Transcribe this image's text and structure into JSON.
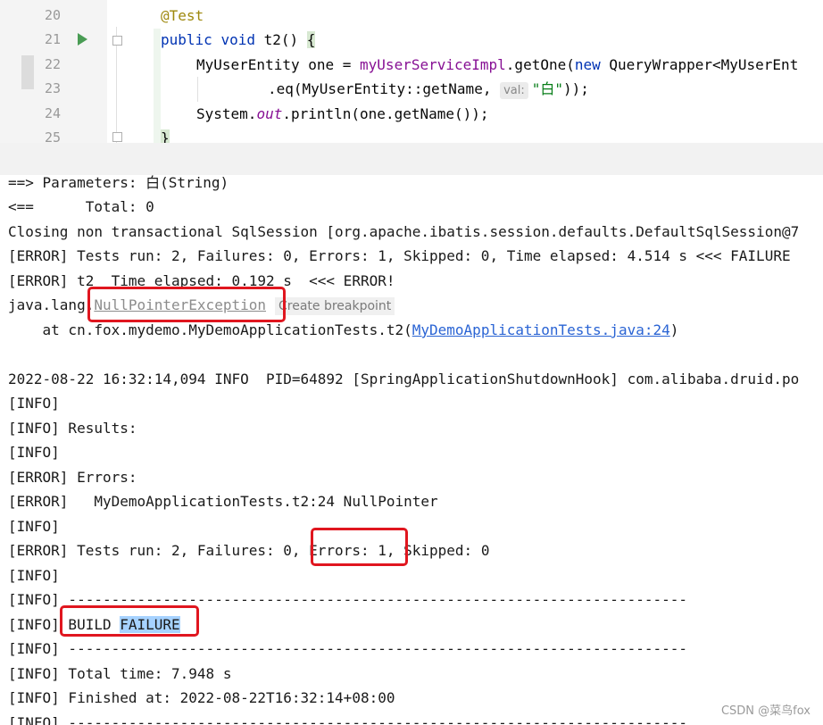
{
  "editor": {
    "line_numbers": [
      "20",
      "21",
      "22",
      "23",
      "24",
      "25"
    ],
    "line20": {
      "annotation": "@Test"
    },
    "line21": {
      "kw_public": "public",
      "kw_void": "void",
      "method": " t2() ",
      "brace": "{"
    },
    "line22": {
      "a": "MyUserEntity one = ",
      "b": "myUserServiceImpl",
      "c": ".getOne(",
      "kw_new": "new",
      "d": " QueryWrapper<MyUserEnt"
    },
    "line23": {
      "a": ".eq(MyUserEntity::getName, ",
      "hint": "val:",
      "str": "\"白\"",
      "b": "));"
    },
    "line24": {
      "a": "System.",
      "out": "out",
      "b": ".println(one.getName());"
    },
    "line25": {
      "brace": "}"
    }
  },
  "console": {
    "l1": "==> Parameters: 白(String)",
    "l2": "<==      Total: 0",
    "l3": "Closing non transactional SqlSession [org.apache.ibatis.session.defaults.DefaultSqlSession@7",
    "l4": "[ERROR] Tests run: 2, Failures: 0, Errors: 1, Skipped: 0, Time elapsed: 4.514 s <<< FAILURE",
    "l5": "[ERROR] t2  Time elapsed: 0.192 s  <<< ERROR!",
    "l6": {
      "prefix": "java.lang.",
      "exception": "NullPointerException",
      "chip": "Create breakpoint"
    },
    "l7": {
      "prefix": "    at cn.fox.mydemo.MyDemoApplicationTests.t2(",
      "link": "MyDemoApplicationTests.java:24",
      "suffix": ")"
    },
    "l9": "2022-08-22 16:32:14,094 INFO  PID=64892 [SpringApplicationShutdownHook] com.alibaba.druid.po",
    "l10": "[INFO]",
    "l11": "[INFO] Results:",
    "l12": "[INFO]",
    "l13": "[ERROR] Errors:",
    "l14": "[ERROR]   MyDemoApplicationTests.t2:24 NullPointer",
    "l15": "[INFO]",
    "l16": {
      "a": "[ERROR] Tests run: 2, Failures: 0, ",
      "b": "Errors: 1",
      "c": ", Skipped: 0"
    },
    "l17": "[INFO]",
    "l18": "[INFO] ------------------------------------------------------------------------",
    "l19": {
      "a": "[INFO] BUILD ",
      "b": "FAILURE"
    },
    "l20": "[INFO] ------------------------------------------------------------------------",
    "l21": "[INFO] Total time: 7.948 s",
    "l22": "[INFO] Finished at: 2022-08-22T16:32:14+08:00",
    "l23": "[INFO] ------------------------------------------------------------------------"
  },
  "watermark": "CSDN @菜鸟fox",
  "colors": {
    "highlight_box": "#e0161f",
    "selection": "#a6d2ff",
    "run_icon": "#499c54"
  }
}
